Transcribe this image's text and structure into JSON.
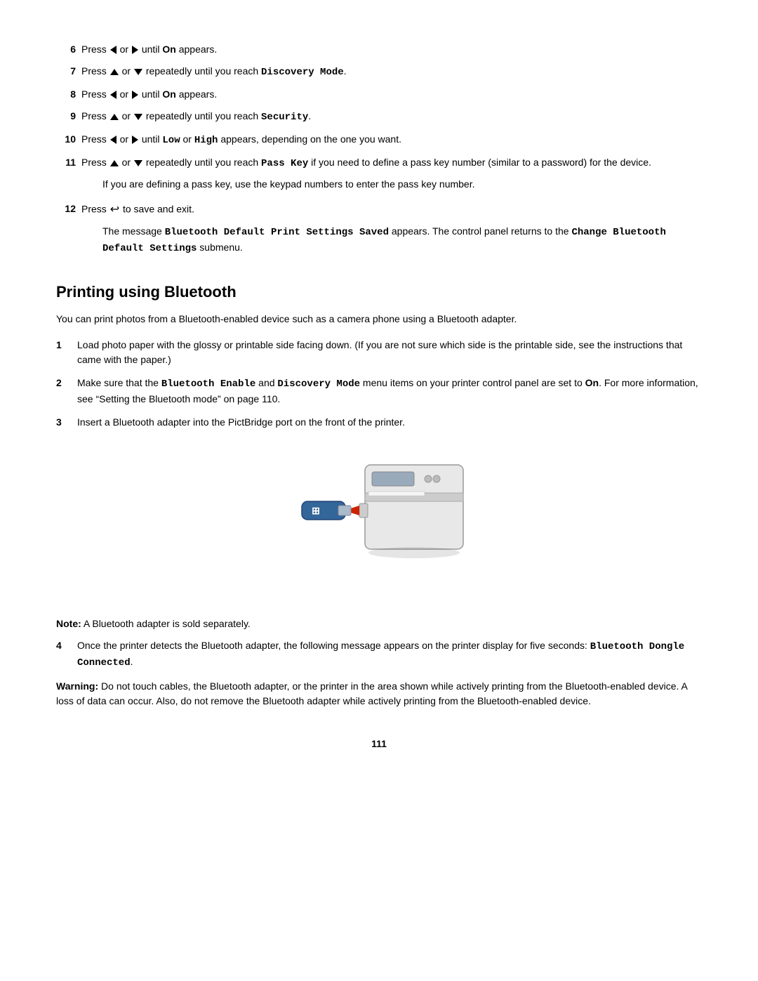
{
  "steps_upper": [
    {
      "num": "6",
      "text_before": "Press",
      "icon1": "arrow-left",
      "mid1": " or ",
      "icon2": "arrow-right",
      "text_after": " until ",
      "bold_after": "On",
      "end": " appears."
    },
    {
      "num": "7",
      "text_before": "Press",
      "icon1": "arrow-up",
      "mid1": " or ",
      "icon2": "arrow-down",
      "text_after": " repeatedly until you reach ",
      "bold_after": "Discovery Mode",
      "end": ".",
      "bold_mono": true
    },
    {
      "num": "8",
      "text_before": "Press",
      "icon1": "arrow-left",
      "mid1": " or ",
      "icon2": "arrow-right",
      "text_after": " until ",
      "bold_after": "On",
      "end": " appears."
    },
    {
      "num": "9",
      "text_before": "Press",
      "icon1": "arrow-up",
      "mid1": " or ",
      "icon2": "arrow-down",
      "text_after": " repeatedly until you reach ",
      "bold_after": "Security",
      "end": ".",
      "bold_mono": true
    },
    {
      "num": "10",
      "text_before": "Press",
      "icon1": "arrow-left",
      "mid1": " or ",
      "icon2": "arrow-right",
      "text_after": " until ",
      "bold1": "Low",
      "mid2": " or ",
      "bold2": "High",
      "end": " appears, depending on the one you want.",
      "bold_mono": true
    },
    {
      "num": "11",
      "text_before": "Press",
      "icon1": "arrow-up",
      "mid1": " or ",
      "icon2": "arrow-down",
      "text_after": " repeatedly until you reach ",
      "bold_after": "Pass Key",
      "end": " if you need to define a pass key number (similar to a password) for the device.",
      "bold_mono": true,
      "sub_text": "If you are defining a pass key, use the keypad numbers to enter the pass key number."
    },
    {
      "num": "12",
      "text_before": "Press",
      "icon1": "save",
      "text_after": " to save and exit.",
      "sub_text": "The message ",
      "sub_bold": "Bluetooth Default Print Settings Saved",
      "sub_end": " appears. The control panel returns to the ",
      "sub_bold2": "Change Bluetooth Default Settings",
      "sub_end2": " submenu."
    }
  ],
  "section": {
    "heading": "Printing using Bluetooth",
    "intro": "You can print photos from a Bluetooth-enabled device such as a camera phone using a Bluetooth adapter."
  },
  "list_steps": [
    {
      "num": "1",
      "text": "Load photo paper with the glossy or printable side facing down. (If you are not sure which side is the printable side, see the instructions that came with the paper.)"
    },
    {
      "num": "2",
      "text_before": "Make sure that the ",
      "bold1": "Bluetooth Enable",
      "mid1": " and ",
      "bold2": "Discovery Mode",
      "text_after": " menu items on your printer control panel are set to ",
      "bold3": "On",
      "end": ". For more information, see “Setting the Bluetooth mode” on page 110."
    },
    {
      "num": "3",
      "text": "Insert a Bluetooth adapter into the PictBridge port on the front of the printer."
    }
  ],
  "note": {
    "label": "Note:",
    "text": " A Bluetooth adapter is sold separately."
  },
  "list_steps2": [
    {
      "num": "4",
      "text_before": "Once the printer detects the Bluetooth adapter, the following message appears on the printer display for five seconds: ",
      "bold": "Bluetooth Dongle Connected",
      "end": "."
    }
  ],
  "warning": {
    "label": "Warning:",
    "text": " Do not touch cables, the Bluetooth adapter, or the printer in the area shown while actively printing from the Bluetooth-enabled device. A loss of data can occur. Also, do not remove the Bluetooth adapter while actively printing from the Bluetooth-enabled device."
  },
  "page_number": "111"
}
